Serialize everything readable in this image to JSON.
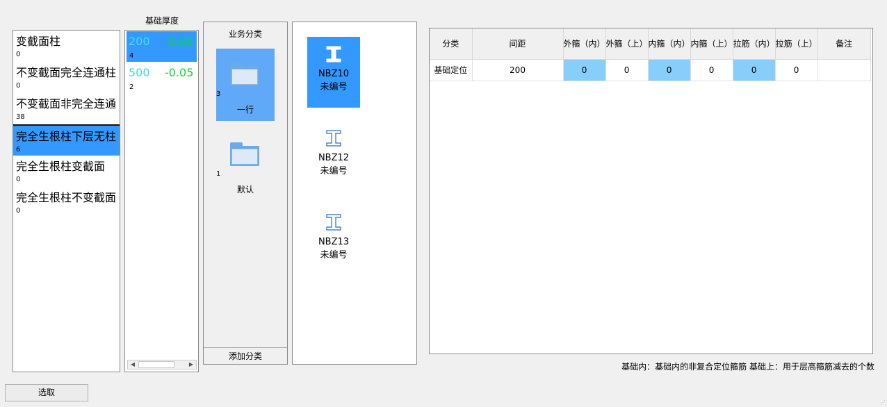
{
  "column_types": {
    "items": [
      {
        "name": "变截面柱",
        "count": "0"
      },
      {
        "name": "不变截面完全连通柱",
        "count": "0"
      },
      {
        "name": "不变截面非完全连通",
        "count": "38"
      },
      {
        "name": "完全生根柱下层无柱",
        "count": "6"
      },
      {
        "name": "完全生根柱变截面",
        "count": "0"
      },
      {
        "name": "完全生根柱不变截面",
        "count": "0"
      }
    ],
    "selected_index": 3
  },
  "thickness": {
    "title": "基础厚度",
    "items": [
      {
        "value": "200",
        "offset": "-0.05",
        "count": "4"
      },
      {
        "value": "500",
        "offset": "-0.05",
        "count": "2"
      }
    ],
    "selected_index": 0,
    "scroll_left": "◀",
    "scroll_right": "▶"
  },
  "categories": {
    "title": "业务分类",
    "items": [
      {
        "label": "一行",
        "count": "3"
      },
      {
        "label": "默认",
        "count": "1"
      }
    ],
    "selected_index": 0,
    "add_button": "添加分类"
  },
  "beams": [
    {
      "name": "NBZ10",
      "sub": "未编号",
      "icon": "i-beam-icon"
    },
    {
      "name": "NBZ12",
      "sub": "未编号",
      "icon": "i-beam-icon"
    },
    {
      "name": "NBZ13",
      "sub": "未编号",
      "icon": "i-beam-icon"
    }
  ],
  "selected_beam": 0,
  "table": {
    "headers": [
      "分类",
      "间距",
      "外箍（内）",
      "外箍（上）",
      "内箍（内）",
      "内箍（上）",
      "拉筋（内）",
      "拉筋（上）",
      "备注"
    ],
    "rows": [
      [
        "基础定位",
        "200",
        "0",
        "0",
        "0",
        "0",
        "0",
        "0",
        ""
      ]
    ],
    "highlight_color": "#87cefa"
  },
  "footnote": "基础内：基础内的非复合定位箍筋    基础上：用于层高箍筋减去的个数",
  "select_button": "选取",
  "colors": {
    "selection": "#3399ff",
    "offset_text": "#00dd33",
    "value_text": "#40e0ff"
  }
}
